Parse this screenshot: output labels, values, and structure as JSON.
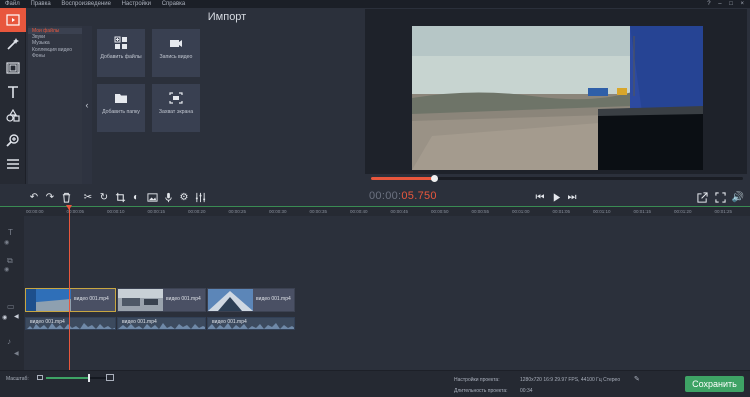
{
  "menubar": {
    "items": [
      "Файл",
      "Правка",
      "Воспроизведение",
      "Настройки",
      "Справка"
    ],
    "window_controls": "? – □ ×"
  },
  "left_tools": [
    "import-icon",
    "magic-wand-icon",
    "filmstrip-icon",
    "text-icon",
    "shapes-icon",
    "zoom-icon",
    "list-icon"
  ],
  "import_panel": {
    "title": "Импорт",
    "categories": [
      "Мои файлы",
      "Звуки",
      "Музыка",
      "Коллекция видео",
      "Фоны"
    ],
    "selected_category": "Мои файлы",
    "tiles": [
      {
        "label": "Добавить файлы",
        "icon": "add-files-icon"
      },
      {
        "label": "Запись видео",
        "icon": "camera-icon"
      },
      {
        "label": "Добавить папку",
        "icon": "folder-icon"
      },
      {
        "label": "Захват экрана",
        "icon": "screen-capture-icon"
      }
    ]
  },
  "player": {
    "progress": 0.17,
    "timecode_prefix": "00:00:",
    "timecode_current": "05.750"
  },
  "timeline": {
    "ruler_labels": [
      "00:00:00",
      "00:00:05",
      "00:00:10",
      "00:00:15",
      "00:00:20",
      "00:00:25",
      "00:00:30",
      "00:00:35",
      "00:00:40",
      "00:00:45",
      "00:00:50",
      "00:00:55",
      "00:01:00",
      "00:01:05",
      "00:01:10",
      "00:01:15",
      "00:01:20",
      "00:01:25",
      "00:01:30"
    ],
    "video_clips": [
      "видео 001.mp4",
      "видео 001.mp4",
      "видео 001.mp4"
    ],
    "audio_clips": [
      "видео 001.mp4",
      "видео 001.mp4",
      "видео 001.mp4"
    ]
  },
  "bottom": {
    "scale_label": "Масштаб:",
    "zoom_level": 0.7,
    "project_settings_label": "Настройки проекта:",
    "project_settings_value": "1280x720 16:9 29.97 FPS, 44100 Гц Стерео",
    "duration_label": "Длительность проекта:",
    "duration_value": "00:34",
    "save_label": "Сохранить"
  },
  "colors": {
    "accent": "#e8573d",
    "save": "#3ea365",
    "background": "#2b303b"
  }
}
